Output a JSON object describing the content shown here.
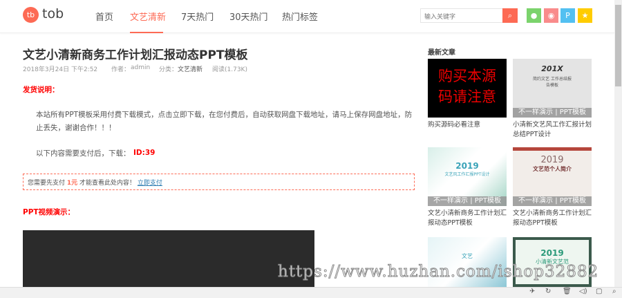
{
  "header": {
    "logo_mark": "tb",
    "logo_text": "tob",
    "nav": [
      {
        "label": "首页"
      },
      {
        "label": "文艺清新",
        "active": true
      },
      {
        "label": "7天热门"
      },
      {
        "label": "30天热门"
      },
      {
        "label": "热门标签"
      }
    ],
    "search_placeholder": "输入关键字",
    "social": [
      {
        "name": "wechat-icon",
        "color": "#7bd36c"
      },
      {
        "name": "weibo-icon",
        "color": "#f98b8b"
      },
      {
        "name": "qq-icon",
        "color": "#53c0f1"
      },
      {
        "name": "star-icon",
        "color": "#ffcc00"
      }
    ]
  },
  "article": {
    "title": "文艺小清新商务工作计划汇报动态PPT模板",
    "date": "2018年3月24日 下午2:52",
    "author_label": "作者：",
    "author": "admin",
    "category_label": "分类：",
    "category": "文艺清新",
    "reads": "阅读(1.73K)",
    "section1": "发货说明：",
    "notice": "本站所有PPT模板采用付费下载模式，点击立即下载，在您付费后，自动获取网盘下载地址，请马上保存网盘地址，防止丢失，谢谢合作！！！",
    "download_label": "以下内容需要支付后，下载：",
    "download_id": "ID:39",
    "pay_prefix": "您需要先支付",
    "pay_amount": "1元",
    "pay_suffix": "才能查看此处内容！",
    "pay_link": "立即支付",
    "section2": "PPT视频演示："
  },
  "sidebar": {
    "title": "最新文章",
    "band_left": "不一样演示",
    "band_right": "PPT模板",
    "items": [
      {
        "caption": "购买源码必看注意",
        "thumb_text": "购买本源码请注意"
      },
      {
        "caption": "小清新文艺风工作汇报计划总结PPT设计",
        "thumb_year": "201X",
        "thumb_sub": "简约文艺 工作总结报告模板"
      },
      {
        "caption": "文艺小清新商务工作计划汇报动态PPT模板",
        "thumb_year": "2019",
        "thumb_sub": "文艺风工作汇报PPT设计"
      },
      {
        "caption": "文艺小清新商务工作计划汇报动态PPT模板",
        "thumb_year": "2019",
        "thumb_sub": "文艺范个人简介"
      },
      {
        "caption": "",
        "thumb_sub": "文艺"
      },
      {
        "caption": "",
        "thumb_year": "2019",
        "thumb_sub": "小清新文艺范"
      }
    ]
  },
  "watermark": "https://www.huzhan.com/ishop32882"
}
